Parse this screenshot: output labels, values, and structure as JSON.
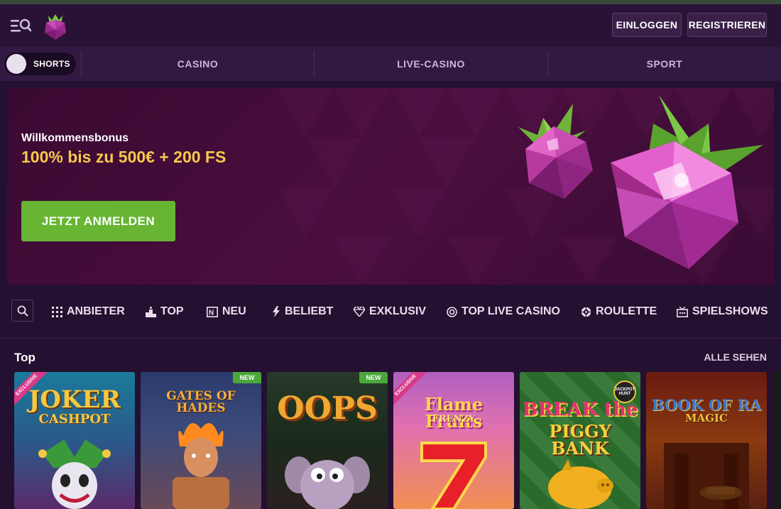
{
  "header": {
    "login_label": "EINLOGGEN",
    "register_label": "REGISTRIEREN"
  },
  "nav": {
    "shorts_label": "SHORTS",
    "tabs": [
      {
        "label": "CASINO"
      },
      {
        "label": "LIVE-CASINO"
      },
      {
        "label": "SPORT"
      }
    ]
  },
  "banner": {
    "bonus_label": "Willkommensbonus",
    "bonus_amount": "100% bis zu 500€ + 200 FS",
    "cta_label": "JETZT ANMELDEN"
  },
  "categories": [
    {
      "label": "ANBIETER",
      "icon": "grid-icon"
    },
    {
      "label": "TOP",
      "icon": "podium-icon"
    },
    {
      "label": "NEU",
      "icon": "new-icon"
    },
    {
      "label": "BELIEBT",
      "icon": "lightning-icon"
    },
    {
      "label": "EXKLUSIV",
      "icon": "diamond-icon"
    },
    {
      "label": "TOP LIVE CASINO",
      "icon": "chip-icon"
    },
    {
      "label": "ROULETTE",
      "icon": "roulette-icon"
    },
    {
      "label": "SPIELSHOWS",
      "icon": "tv-icon"
    }
  ],
  "section": {
    "title": "Top",
    "see_all_label": "ALLE SEHEN"
  },
  "games": [
    {
      "title": "JOKER",
      "subtitle": "CASHPOT",
      "badge": "EXCLUSIVE"
    },
    {
      "title": "GATES OF HADES",
      "badge": "NEW"
    },
    {
      "title": "OOPS",
      "badge": "NEW"
    },
    {
      "title": "Flame Fruits",
      "subtitle": "FRENZY",
      "badge": "EXCLUSIVE"
    },
    {
      "title": "BREAK the",
      "subtitle": "PIGGY BANK",
      "corner_badge": "JACKPOT HUNT"
    },
    {
      "title": "BOOK OF RA",
      "subtitle": "MAGIC"
    }
  ],
  "colors": {
    "accent_green": "#67b532",
    "bonus_gold": "#f7c94a",
    "background": "#241030"
  }
}
